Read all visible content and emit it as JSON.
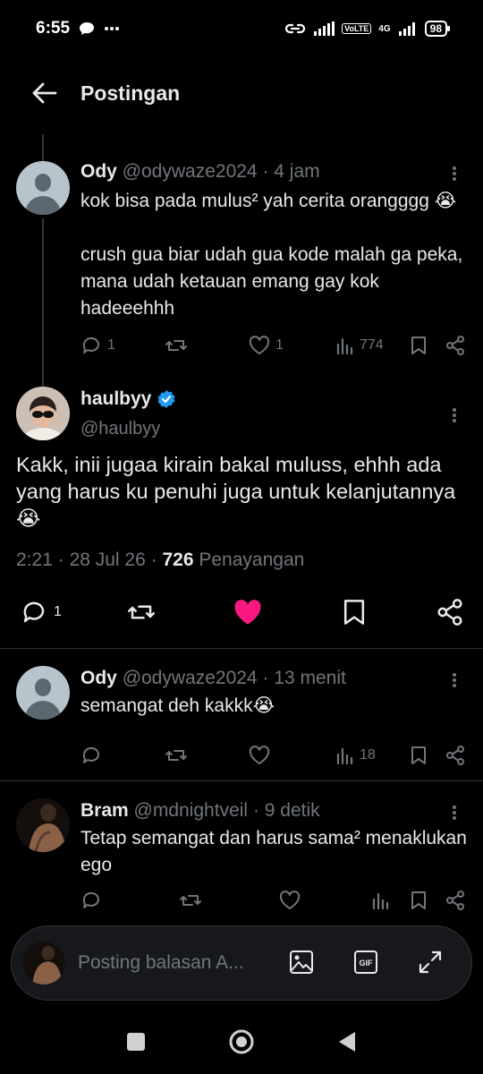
{
  "status_bar": {
    "time": "6:55",
    "battery": "98",
    "network": "4G",
    "volte": "VoLTE"
  },
  "header": {
    "title": "Postingan"
  },
  "parent_post": {
    "name": "Ody",
    "handle": "@odywaze2024",
    "time": "4 jam",
    "line1": "kok bisa pada mulus² yah cerita orangggg 😭",
    "line2": "crush gua biar udah gua kode malah ga peka, mana udah ketauan emang gay kok hadeeehhh",
    "replies": "1",
    "likes": "1",
    "views": "774"
  },
  "main_post": {
    "name": "haulbyy",
    "handle": "@haulbyy",
    "verified": true,
    "text": "Kakk, inii jugaa kirain bakal muluss, ehhh ada yang harus ku penuhi juga untuk kelanjutannya 😭",
    "time": "2:21",
    "date": "28 Jul 26",
    "views_count": "726",
    "views_label": "Penayangan",
    "replies": "1",
    "liked": true,
    "like_color": "#f91880"
  },
  "replies": [
    {
      "name": "Ody",
      "handle": "@odywaze2024",
      "time": "13 menit",
      "text": "semangat deh kakkk😭",
      "views": "18"
    },
    {
      "name": "Bram",
      "handle": "@mdnightveil",
      "time": "9 detik",
      "text": "Tetap semangat dan harus sama² menaklukan ego"
    }
  ],
  "reply_bar": {
    "placeholder": "Posting balasan A..."
  },
  "colors": {
    "background": "#000000",
    "text": "#e7e9ea",
    "muted": "#71767b",
    "verified": "#1d9bf0",
    "like": "#f91880"
  }
}
